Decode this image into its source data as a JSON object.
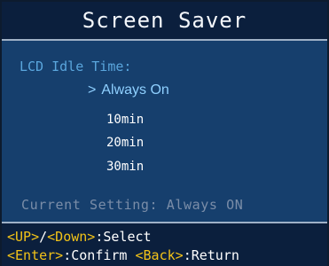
{
  "title": "Screen Saver",
  "idle_label": "LCD Idle Time:",
  "options": [
    {
      "label": "Always On",
      "selected": true,
      "marker": ">"
    },
    {
      "label": "10min",
      "selected": false
    },
    {
      "label": "20min",
      "selected": false
    },
    {
      "label": "30min",
      "selected": false
    }
  ],
  "current_setting": "Current Setting: Always ON",
  "footer": {
    "line1": {
      "up_key": "<UP>",
      "slash": "/",
      "down_key": "<Down>",
      "action": ":Select"
    },
    "line2": {
      "enter_key": "<Enter>",
      "enter_action": ":Confirm ",
      "back_key": "<Back>",
      "back_action": ":Return"
    }
  },
  "colors": {
    "title_bg": "#0b1f3d",
    "content_bg": "#163f6d",
    "label": "#5aa6dd",
    "selected": "#8fd0ff",
    "key_highlight": "#f3c318",
    "muted": "#7a8da8"
  }
}
